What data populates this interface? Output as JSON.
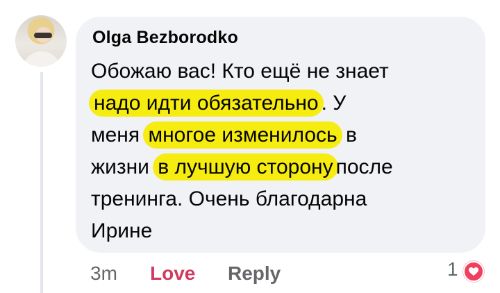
{
  "comment": {
    "author": "Olga Bezborodko",
    "lines": [
      [
        {
          "t": "Обожаю вас! Кто ещё не знает"
        }
      ],
      [
        {
          "t": "надо идти обязательно",
          "hl": true
        },
        {
          "t": ".  У"
        }
      ],
      [
        {
          "t": "меня "
        },
        {
          "t": "многое изменилось",
          "hl": true
        },
        {
          "t": " в"
        }
      ],
      [
        {
          "t": "жизни "
        },
        {
          "t": "в лучшую сторону",
          "hl": true
        },
        {
          "t": "после"
        }
      ],
      [
        {
          "t": "тренинга. Очень благодарна"
        }
      ],
      [
        {
          "t": "Ирине"
        }
      ]
    ],
    "highlight_color": "#f7ec0f"
  },
  "actions": {
    "time": "3m",
    "love": "Love",
    "reply": "Reply"
  },
  "reactions": {
    "count": "1",
    "icon": "heart-icon"
  }
}
